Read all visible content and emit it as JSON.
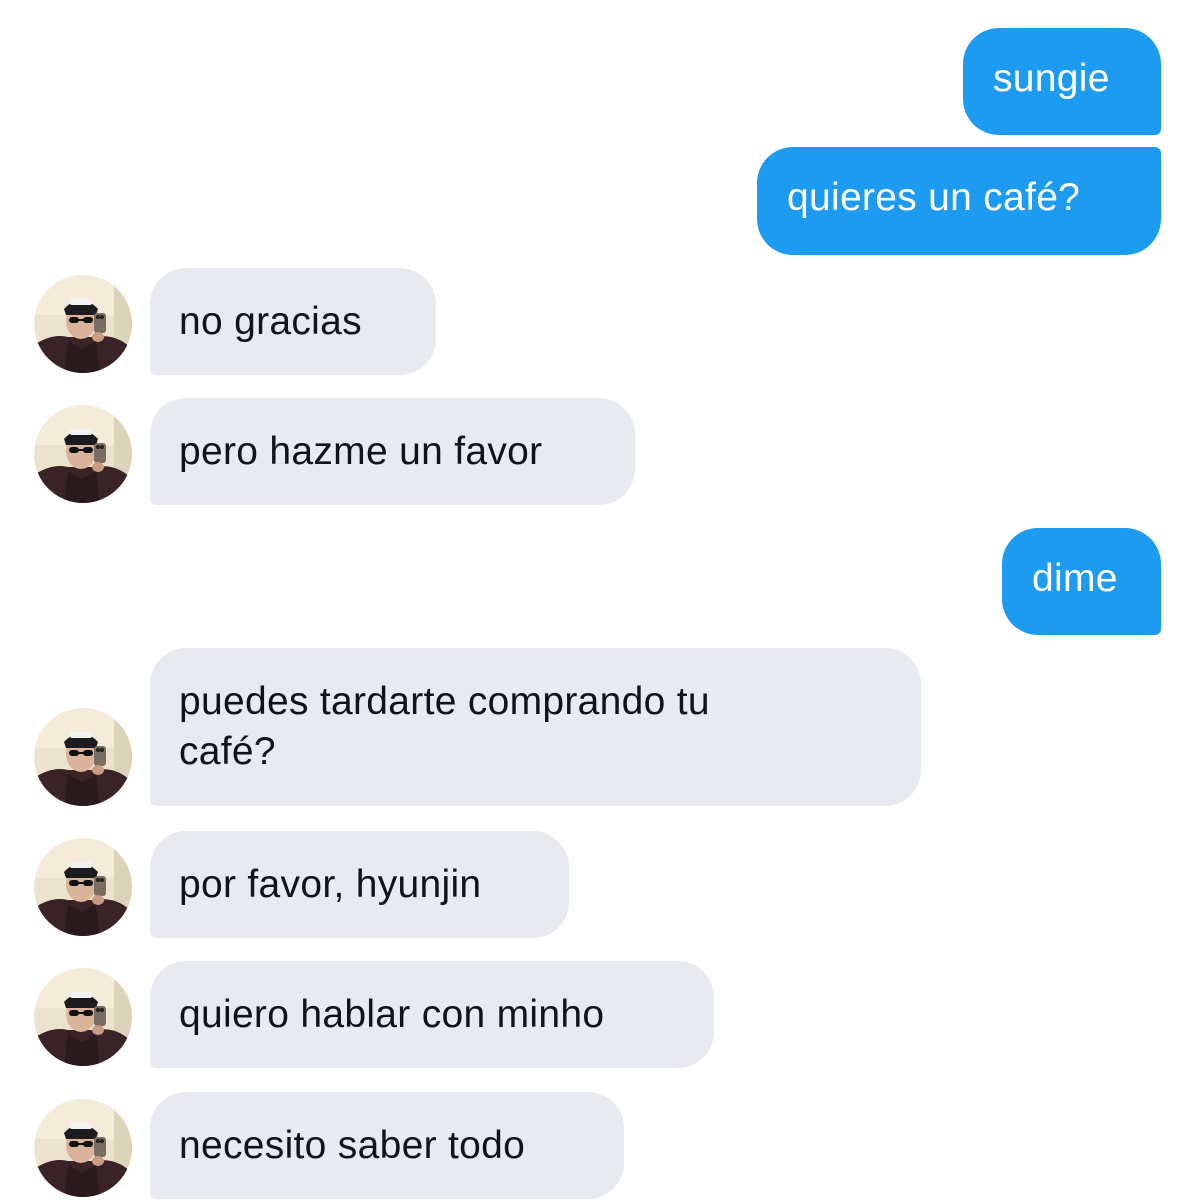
{
  "conversation": {
    "messages": [
      {
        "from": "me",
        "text": "sungie"
      },
      {
        "from": "me",
        "text": "quieres un café?"
      },
      {
        "from": "them",
        "text": "no gracias",
        "avatar": "contact-avatar"
      },
      {
        "from": "them",
        "text": "pero hazme un favor",
        "avatar": "contact-avatar"
      },
      {
        "from": "me",
        "text": "dime"
      },
      {
        "from": "them",
        "lines": [
          "puedes tardarte comprando tu",
          "café?"
        ],
        "avatar": "contact-avatar"
      },
      {
        "from": "them",
        "text": "por favor, hyunjin",
        "avatar": "contact-avatar"
      },
      {
        "from": "them",
        "text": "quiero hablar con minho",
        "avatar": "contact-avatar"
      },
      {
        "from": "them",
        "text": "necesito saber todo",
        "avatar": "contact-avatar"
      }
    ]
  },
  "colors": {
    "sent_bubble": "#1d9bf0",
    "sent_text": "#ffffff",
    "received_bubble": "#e7ebf0",
    "received_text": "#0f1419",
    "background": "#ffffff"
  }
}
